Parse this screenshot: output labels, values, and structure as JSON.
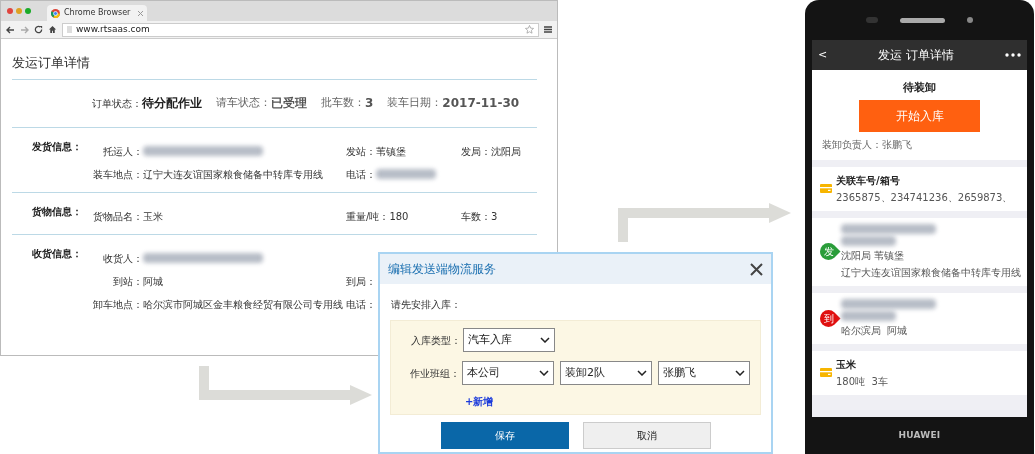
{
  "browser": {
    "tab_title": "Chrome Browser",
    "address": "www.rtsaas.com"
  },
  "page": {
    "title": "发运订单详情",
    "status": [
      {
        "kind": "main",
        "label": "订单状态：",
        "value": "待分配作业"
      },
      {
        "kind": "other",
        "label": "请车状态：",
        "value": "已受理"
      },
      {
        "kind": "other",
        "label": "批车数：",
        "value": "3"
      },
      {
        "kind": "other",
        "label": "装车日期：",
        "value": "2017-11-30"
      }
    ],
    "sections": [
      {
        "label": "发货信息：",
        "rows": [
          [
            {
              "label": "托运人：",
              "redacted": true
            },
            {
              "label": "发站：",
              "value": "苇镇堡"
            },
            {
              "label": "发局：",
              "value": "沈阳局"
            }
          ],
          [
            {
              "label": "装车地点：",
              "value": "辽宁大连友谊国家粮食储备中转库专用线"
            },
            {
              "label": "电话：",
              "redacted": true
            }
          ]
        ]
      },
      {
        "label": "货物信息：",
        "rows": [
          [
            {
              "label": "货物品名：",
              "value": "玉米"
            },
            {
              "label": "重量/吨：",
              "value": "180"
            },
            {
              "label": "车数：",
              "value": "3"
            }
          ]
        ]
      },
      {
        "label": "收货信息：",
        "rows": [
          [
            {
              "label": "收货人：",
              "redacted": true
            }
          ],
          [
            {
              "label": "到站：",
              "value": "阿城"
            },
            {
              "label": "到局："
            }
          ],
          [
            {
              "label": "卸车地点：",
              "value": "哈尔滨市阿城区金丰粮食经贸有限公司专用线"
            },
            {
              "label": "电话："
            }
          ]
        ]
      }
    ]
  },
  "dialog": {
    "title": "编辑发送端物流服务",
    "prompt": "请先安排入库：",
    "type_field": {
      "label": "入库类型：",
      "value": "汽车入库"
    },
    "team_field": {
      "label": "作业班组：",
      "values": [
        "本公司",
        "装卸2队",
        "张鹏飞"
      ]
    },
    "add_link": "+新增",
    "buttons": [
      {
        "label": "保存",
        "kind": "primary"
      },
      {
        "label": "取消",
        "kind": "secondary"
      }
    ]
  },
  "phone": {
    "back": "<",
    "title": "发运 订单详情",
    "status": "待装卸",
    "action": "开始入库",
    "manager": "装卸负责人：张鹏飞",
    "cards": [
      {
        "kind": "cargo",
        "title": "关联车号/箱号",
        "lines": [
          "2365875、234741236、2659873、"
        ]
      },
      {
        "kind": "place",
        "pin": "发",
        "color": "#2a9d3a",
        "lines": [
          "沈阳局 苇镇堡",
          "辽宁大连友谊国家粮食储备中转库专用线"
        ]
      },
      {
        "kind": "place",
        "pin": "到",
        "color": "#e01010",
        "lines": [
          "哈尔滨局  阿城"
        ]
      },
      {
        "kind": "cargo",
        "title": "玉米",
        "lines": [
          "180吨  3车"
        ]
      }
    ],
    "brand": "HUAWEI"
  }
}
